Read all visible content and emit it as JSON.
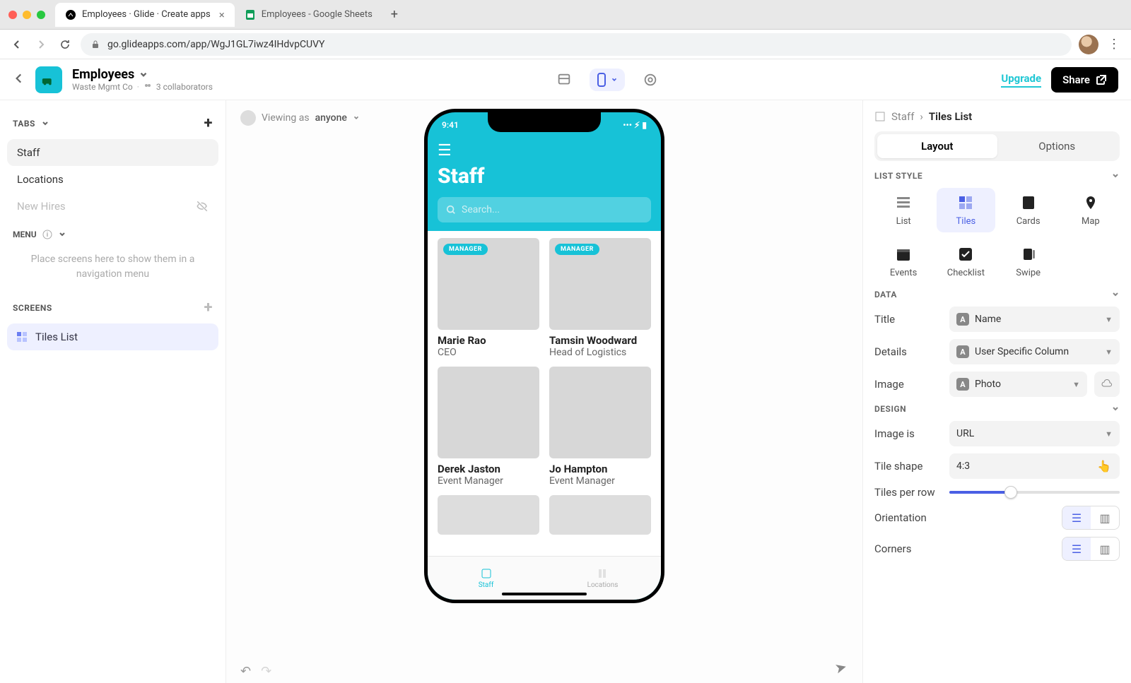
{
  "browser": {
    "tabs": [
      {
        "title": "Employees · Glide · Create apps",
        "favicon": "glide"
      },
      {
        "title": "Employees - Google Sheets",
        "favicon": "sheets"
      }
    ],
    "url": "go.glideapps.com/app/WgJ1GL7iwz4IHdvpCUVY"
  },
  "app": {
    "name": "Employees",
    "org": "Waste Mgmt Co",
    "collaborators": "3 collaborators",
    "upgrade": "Upgrade",
    "share": "Share"
  },
  "left": {
    "tabs_label": "TABS",
    "tabs": [
      {
        "label": "Staff",
        "active": true
      },
      {
        "label": "Locations"
      },
      {
        "label": "New Hires",
        "hidden": true
      }
    ],
    "menu_label": "MENU",
    "menu_placeholder": "Place screens here to show them in a navigation menu",
    "screens_label": "SCREENS",
    "screens": [
      {
        "label": "Tiles List"
      }
    ]
  },
  "canvas": {
    "viewing_label": "Viewing as",
    "viewing_value": "anyone",
    "status_time": "9:41",
    "screen_title": "Staff",
    "search_placeholder": "Search...",
    "manager_badge": "MANAGER",
    "staff": [
      {
        "name": "Marie Rao",
        "role": "CEO",
        "badge": true,
        "face": "face1"
      },
      {
        "name": "Tamsin Woodward",
        "role": "Head of Logistics",
        "badge": true,
        "face": "face2"
      },
      {
        "name": "Derek Jaston",
        "role": "Event Manager",
        "face": "face3"
      },
      {
        "name": "Jo Hampton",
        "role": "Event Manager",
        "face": "face4"
      }
    ],
    "bottom_nav": [
      {
        "label": "Staff",
        "active": true
      },
      {
        "label": "Locations"
      }
    ]
  },
  "right": {
    "crumb_parent": "Staff",
    "crumb_current": "Tiles List",
    "seg_layout": "Layout",
    "seg_options": "Options",
    "list_style_label": "LIST STYLE",
    "styles": [
      "List",
      "Tiles",
      "Cards",
      "Map",
      "Events",
      "Checklist",
      "Swipe"
    ],
    "active_style": "Tiles",
    "data_label": "DATA",
    "title_label": "Title",
    "title_value": "Name",
    "details_label": "Details",
    "details_value": "User Specific Column",
    "image_label": "Image",
    "image_value": "Photo",
    "design_label": "DESIGN",
    "imageis_label": "Image is",
    "imageis_value": "URL",
    "tileshape_label": "Tile shape",
    "tileshape_value": "4:3",
    "tilesperrow_label": "Tiles per row",
    "orientation_label": "Orientation",
    "corners_label": "Corners"
  }
}
